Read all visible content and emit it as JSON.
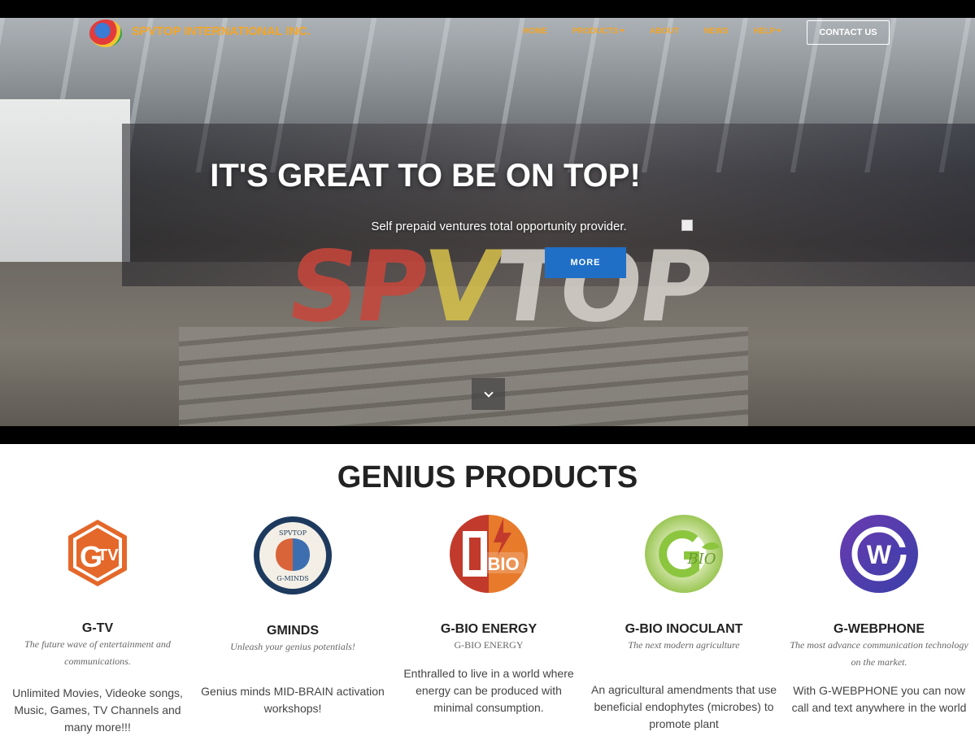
{
  "nav": {
    "brand": "SPVTOP INTERNATIONAL INC.",
    "items": [
      "HOME",
      "PRODUCTS",
      "ABOUT",
      "NEWS",
      "HELP"
    ],
    "contact": "CONTACT US"
  },
  "hero": {
    "title": "IT'S GREAT TO BE ON TOP!",
    "subtitle": "Self prepaid ventures total opportunity provider.",
    "button": "MORE",
    "sign_letters": [
      "S",
      "P",
      "V",
      "T",
      "O",
      "P"
    ]
  },
  "products_title": "GENIUS PRODUCTS",
  "products": [
    {
      "name": "G-TV",
      "tagline": "The future wave of entertainment and communications.",
      "description": "Unlimited Movies, Videoke songs, Music, Games, TV Channels and many more!!!",
      "icon": "gtv-logo-icon",
      "icon_text": "TV"
    },
    {
      "name": "GMINDS",
      "tagline": "Unleash your genius potentials!",
      "description": "Genius minds MID-BRAIN activation workshops!",
      "icon": "gminds-logo-icon",
      "icon_text": "SPVTOP G-MINDS"
    },
    {
      "name": "G-BIO ENERGY",
      "tagline": "G-BIO ENERGY",
      "description": "Enthralled to live in a world where energy can be produced with minimal consumption.",
      "icon": "gbio-energy-logo-icon",
      "icon_text": "BIO"
    },
    {
      "name": "G-BIO INOCULANT",
      "tagline": "The next modern agriculture",
      "description": "An agricultural amendments that use beneficial endophytes (microbes) to promote plant",
      "icon": "gbio-inoculant-logo-icon",
      "icon_text": "BIO"
    },
    {
      "name": "G-WEBPHONE",
      "tagline": "The most advance communication technology on the market.",
      "description": "With G-WEBPHONE you can now call and text anywhere in the world",
      "icon": "gwebphone-logo-icon",
      "icon_text": "W"
    }
  ],
  "colors": {
    "accent": "#f5a623",
    "button": "#1f6fc7"
  }
}
